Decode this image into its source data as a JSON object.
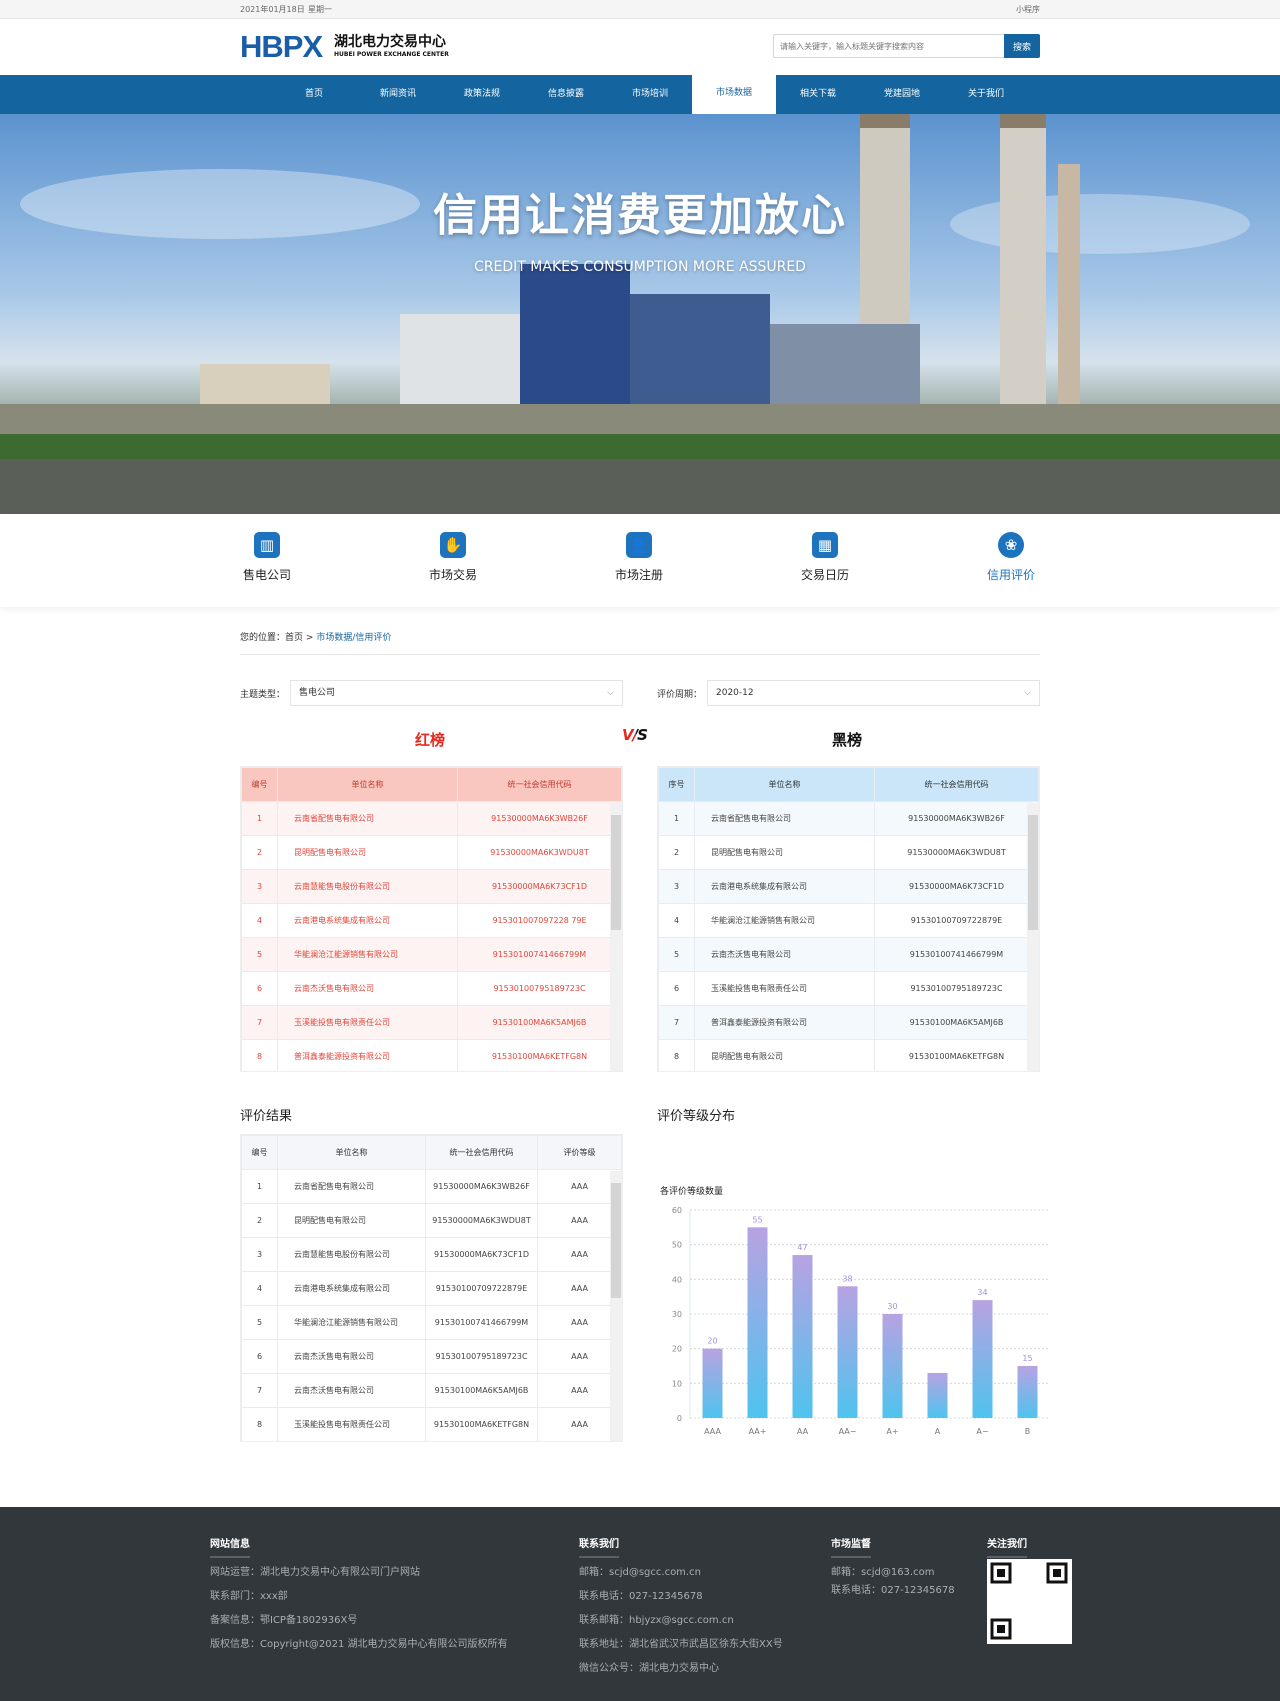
{
  "topbar": {
    "date": "2021年01月18日",
    "weekday": "星期一",
    "mini_program": "小程序"
  },
  "header": {
    "logo_mark": "HBPX",
    "logo_cn": "湖北电力交易中心",
    "logo_en": "HUBEI POWER EXCHANGE CENTER",
    "search_placeholder": "请输入关键字，输入标题关键字搜索内容",
    "search_button": "搜索"
  },
  "nav": [
    {
      "label": "首页"
    },
    {
      "label": "新闻资讯"
    },
    {
      "label": "政策法规"
    },
    {
      "label": "信息披露"
    },
    {
      "label": "市场培训"
    },
    {
      "label": "市场数据",
      "active": true
    },
    {
      "label": "相关下载"
    },
    {
      "label": "党建园地"
    },
    {
      "label": "关于我们"
    }
  ],
  "hero": {
    "title": "信用让消费更加放心",
    "subtitle": "CREDIT MAKES CONSUMPTION MORE ASSURED"
  },
  "quick_links": [
    {
      "label": "售电公司",
      "icon": "building-icon"
    },
    {
      "label": "市场交易",
      "icon": "handshake-icon"
    },
    {
      "label": "市场注册",
      "icon": "user-add-icon"
    },
    {
      "label": "交易日历",
      "icon": "calendar-icon"
    },
    {
      "label": "信用评价",
      "icon": "credit-icon",
      "active": true
    }
  ],
  "breadcrumb": {
    "prefix": "您的位置：",
    "home": "首页",
    "sep": ">",
    "current": "市场数据/信用评价"
  },
  "filters": {
    "subject_label": "主题类型：",
    "subject_value": "售电公司",
    "period_label": "评价周期：",
    "period_value": "2020-12"
  },
  "board": {
    "red_title": "红榜",
    "vs": "V/S",
    "black_title": "黑榜"
  },
  "red_table": {
    "headers": [
      "编号",
      "单位名称",
      "统一社会信用代码"
    ],
    "rows": [
      [
        "1",
        "云南省配售电有限公司",
        "91530000MA6K3WB26F"
      ],
      [
        "2",
        "昆明配售电有限公司",
        "91530000MA6K3WDU8T"
      ],
      [
        "3",
        "云南慧能售电股份有限公司",
        "91530000MA6K73CF1D"
      ],
      [
        "4",
        "云南港电系统集成有限公司",
        "915301007097228 79E"
      ],
      [
        "5",
        "华能澜沧江能源销售有限公司",
        "91530100741466799M"
      ],
      [
        "6",
        "云南杰沃售电有限公司",
        "91530100795189723C"
      ],
      [
        "7",
        "玉溪能投售电有限责任公司",
        "91530100MA6K5AMJ6B"
      ],
      [
        "8",
        "普洱鑫泰能源投资有限公司",
        "91530100MA6KETFG8N"
      ]
    ]
  },
  "black_table": {
    "headers": [
      "序号",
      "单位名称",
      "统一社会信用代码"
    ],
    "rows": [
      [
        "1",
        "云南省配售电有限公司",
        "91530000MA6K3WB26F"
      ],
      [
        "2",
        "昆明配售电有限公司",
        "91530000MA6K3WDU8T"
      ],
      [
        "3",
        "云南港电系统集成有限公司",
        "91530000MA6K73CF1D"
      ],
      [
        "4",
        "华能澜沧江能源销售有限公司",
        "91530100709722879E"
      ],
      [
        "5",
        "云南杰沃售电有限公司",
        "91530100741466799M"
      ],
      [
        "6",
        "玉溪能投售电有限责任公司",
        "91530100795189723C"
      ],
      [
        "7",
        "普洱鑫泰能源投资有限公司",
        "91530100MA6K5AMJ6B"
      ],
      [
        "8",
        "昆明配售电有限公司",
        "91530100MA6KETFG8N"
      ]
    ]
  },
  "results": {
    "title": "评价结果",
    "headers": [
      "编号",
      "单位名称",
      "统一社会信用代码",
      "评价等级"
    ],
    "rows": [
      [
        "1",
        "云南省配售电有限公司",
        "91530000MA6K3WB26F",
        "AAA"
      ],
      [
        "2",
        "昆明配售电有限公司",
        "91530000MA6K3WDU8T",
        "AAA"
      ],
      [
        "3",
        "云南慧能售电股份有限公司",
        "91530000MA6K73CF1D",
        "AAA"
      ],
      [
        "4",
        "云南港电系统集成有限公司",
        "91530100709722879E",
        "AAA"
      ],
      [
        "5",
        "华能澜沧江能源销售有限公司",
        "91530100741466799M",
        "AAA"
      ],
      [
        "6",
        "云南杰沃售电有限公司",
        "91530100795189723C",
        "AAA"
      ],
      [
        "7",
        "云南杰沃售电有限公司",
        "91530100MA6K5AMJ6B",
        "AAA"
      ],
      [
        "8",
        "玉溪能投售电有限责任公司",
        "91530100MA6KETFG8N",
        "AAA"
      ]
    ]
  },
  "distribution": {
    "title": "评价等级分布"
  },
  "chart_data": {
    "type": "bar",
    "title": "各评价等级数量",
    "categories": [
      "AAA",
      "AA+",
      "AA",
      "AA−",
      "A+",
      "A",
      "A−",
      "B"
    ],
    "values": [
      20,
      55,
      47,
      38,
      30,
      13,
      34,
      15
    ],
    "labels_shown": [
      true,
      true,
      true,
      true,
      true,
      false,
      true,
      true
    ],
    "ylim": [
      0,
      60
    ],
    "yticks": [
      0,
      10,
      20,
      30,
      40,
      50,
      60
    ],
    "grid": true,
    "colors": {
      "top": "#b8a2e2",
      "bottom": "#4fc3ee",
      "label": "#a58fe0"
    }
  },
  "footer": {
    "site": {
      "title": "网站信息",
      "lines": [
        "网站运营：湖北电力交易中心有限公司门户网站",
        "联系部门：xxx部",
        "备案信息：鄂ICP备1802936X号",
        "版权信息：Copyright@2021 湖北电力交易中心有限公司版权所有"
      ]
    },
    "contact": {
      "title": "联系我们",
      "lines": [
        "邮箱：scjd@sgcc.com.cn",
        "联系电话：027-12345678",
        "联系邮箱：hbjyzx@sgcc.com.cn",
        "联系地址：湖北省武汉市武昌区徐东大街XX号",
        "微信公众号：湖北电力交易中心"
      ]
    },
    "supervision": {
      "title": "市场监督",
      "lines": [
        "邮箱：scjd@163.com",
        "联系电话：027-12345678"
      ]
    },
    "follow": {
      "title": "关注我们"
    }
  },
  "colors": {
    "primary": "#14659f",
    "red": "#e2463a",
    "footer_bg": "#32373c"
  }
}
